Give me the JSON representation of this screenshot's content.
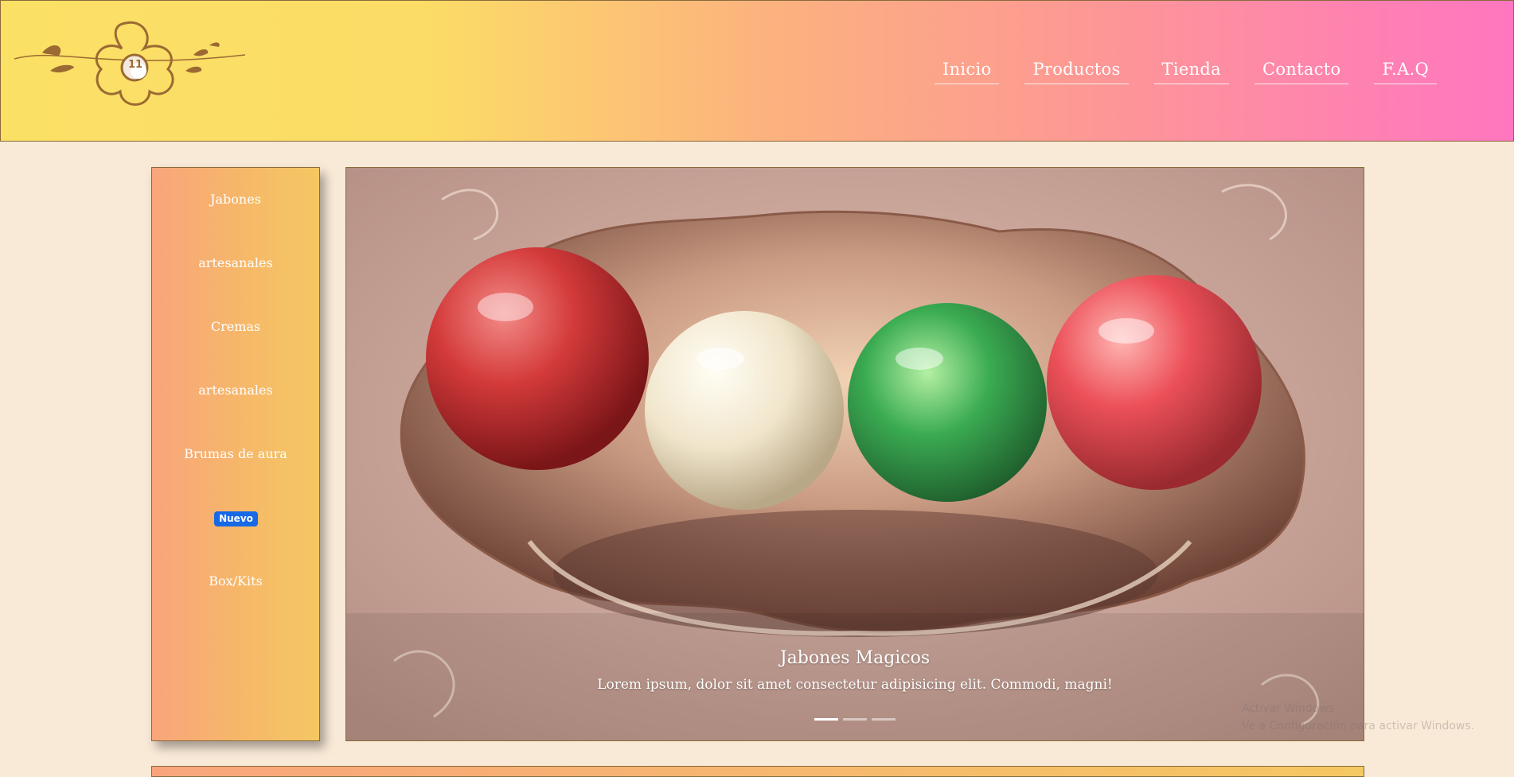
{
  "nav": {
    "items": [
      {
        "label": "Inicio"
      },
      {
        "label": "Productos"
      },
      {
        "label": "Tienda"
      },
      {
        "label": "Contacto"
      },
      {
        "label": "F.A.Q"
      }
    ]
  },
  "logo": {
    "icon": "flower-logo-icon",
    "text": "11"
  },
  "sidebar": {
    "items": [
      {
        "label": "Jabones"
      },
      {
        "label": "artesanales"
      },
      {
        "label": "Cremas"
      },
      {
        "label": "artesanales"
      },
      {
        "label": "Brumas de aura"
      },
      {
        "label": "Box/Kits"
      }
    ],
    "badge": "Nuevo"
  },
  "carousel": {
    "title": "Jabones Magicos",
    "text": "Lorem ipsum, dolor sit amet consectetur adipisicing elit. Commodi, magni!",
    "active_index": 0,
    "slides": 3
  },
  "watermark": {
    "line1": "Activar Windows",
    "line2": "Ve a Configuración para activar Windows."
  },
  "colors": {
    "background": "#f9ead8",
    "header_gradient_start": "#fbe066",
    "header_gradient_end": "#ff76c0",
    "sidebar_start": "#f8a57c",
    "sidebar_end": "#f4c862",
    "badge": "#1769e6"
  }
}
